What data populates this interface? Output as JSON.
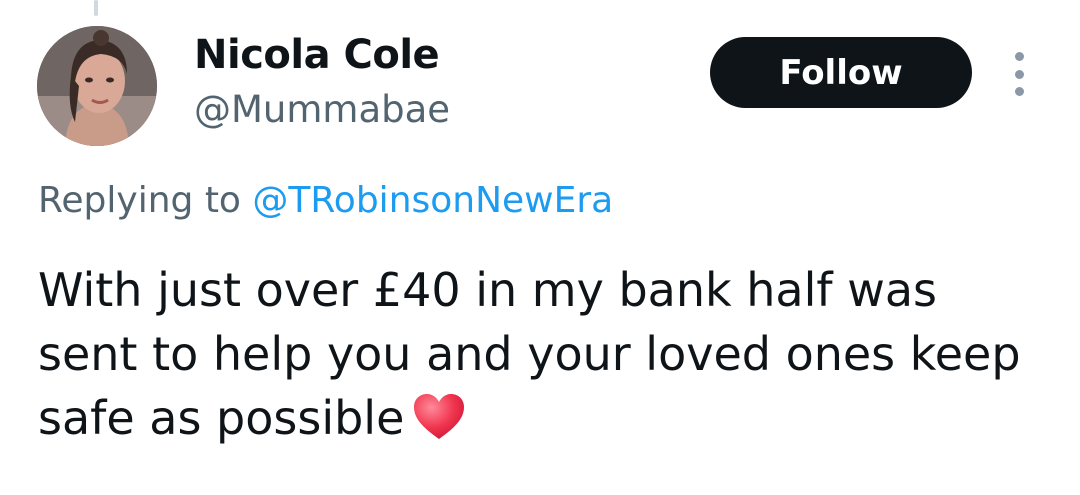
{
  "author": {
    "display_name": "Nicola Cole",
    "handle": "@Mummabae"
  },
  "follow_label": "Follow",
  "reply": {
    "prefix": "Replying to",
    "mention": "@TRobinsonNewEra"
  },
  "tweet": {
    "text": "With just over £40 in my bank half was sent to help you and your loved ones keep safe as possible",
    "emoji": "heart-icon"
  },
  "colors": {
    "primary_text": "#0f1419",
    "secondary_text": "#536471",
    "link": "#1d9bf0",
    "follow_bg": "#0f1419",
    "heart": "#f0354e"
  }
}
